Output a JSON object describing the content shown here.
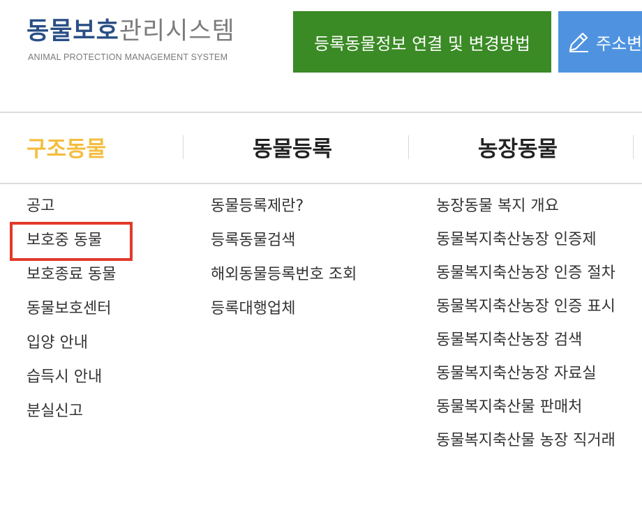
{
  "header": {
    "logo_title_main": "동물보호",
    "logo_title_sub": "관리시스템",
    "logo_subtitle": "ANIMAL PROTECTION MANAGEMENT SYSTEM",
    "green_button_label": "등록동물정보 연결 및 변경방법",
    "blue_button_label": "주소변",
    "colors": {
      "green": "#3a8a25",
      "blue": "#4f93e0",
      "logo_blue": "#2a4f86"
    }
  },
  "nav": {
    "tabs": [
      {
        "label": "구조동물",
        "active": true
      },
      {
        "label": "동물등록",
        "active": false
      },
      {
        "label": "농장동물",
        "active": false
      }
    ],
    "active_color": "#f4bd3f"
  },
  "menu": {
    "rescue": [
      "공고",
      "보호중 동물",
      "보호종료 동물",
      "동물보호센터",
      "입양 안내",
      "습득시 안내",
      "분실신고"
    ],
    "registration": [
      "동물등록제란?",
      "등록동물검색",
      "해외동물등록번호 조회",
      "등록대행업체"
    ],
    "farm": [
      "농장동물 복지 개요",
      "동물복지축산농장 인증제",
      "동물복지축산농장 인증 절차",
      "동물복지축산농장 인증 표시",
      "동물복지축산농장 검색",
      "동물복지축산농장 자료실",
      "동물복지축산물 판매처",
      "동물복지축산물 농장 직거래"
    ]
  },
  "highlight": {
    "target": "보호중 동물",
    "color": "#e2392a"
  }
}
